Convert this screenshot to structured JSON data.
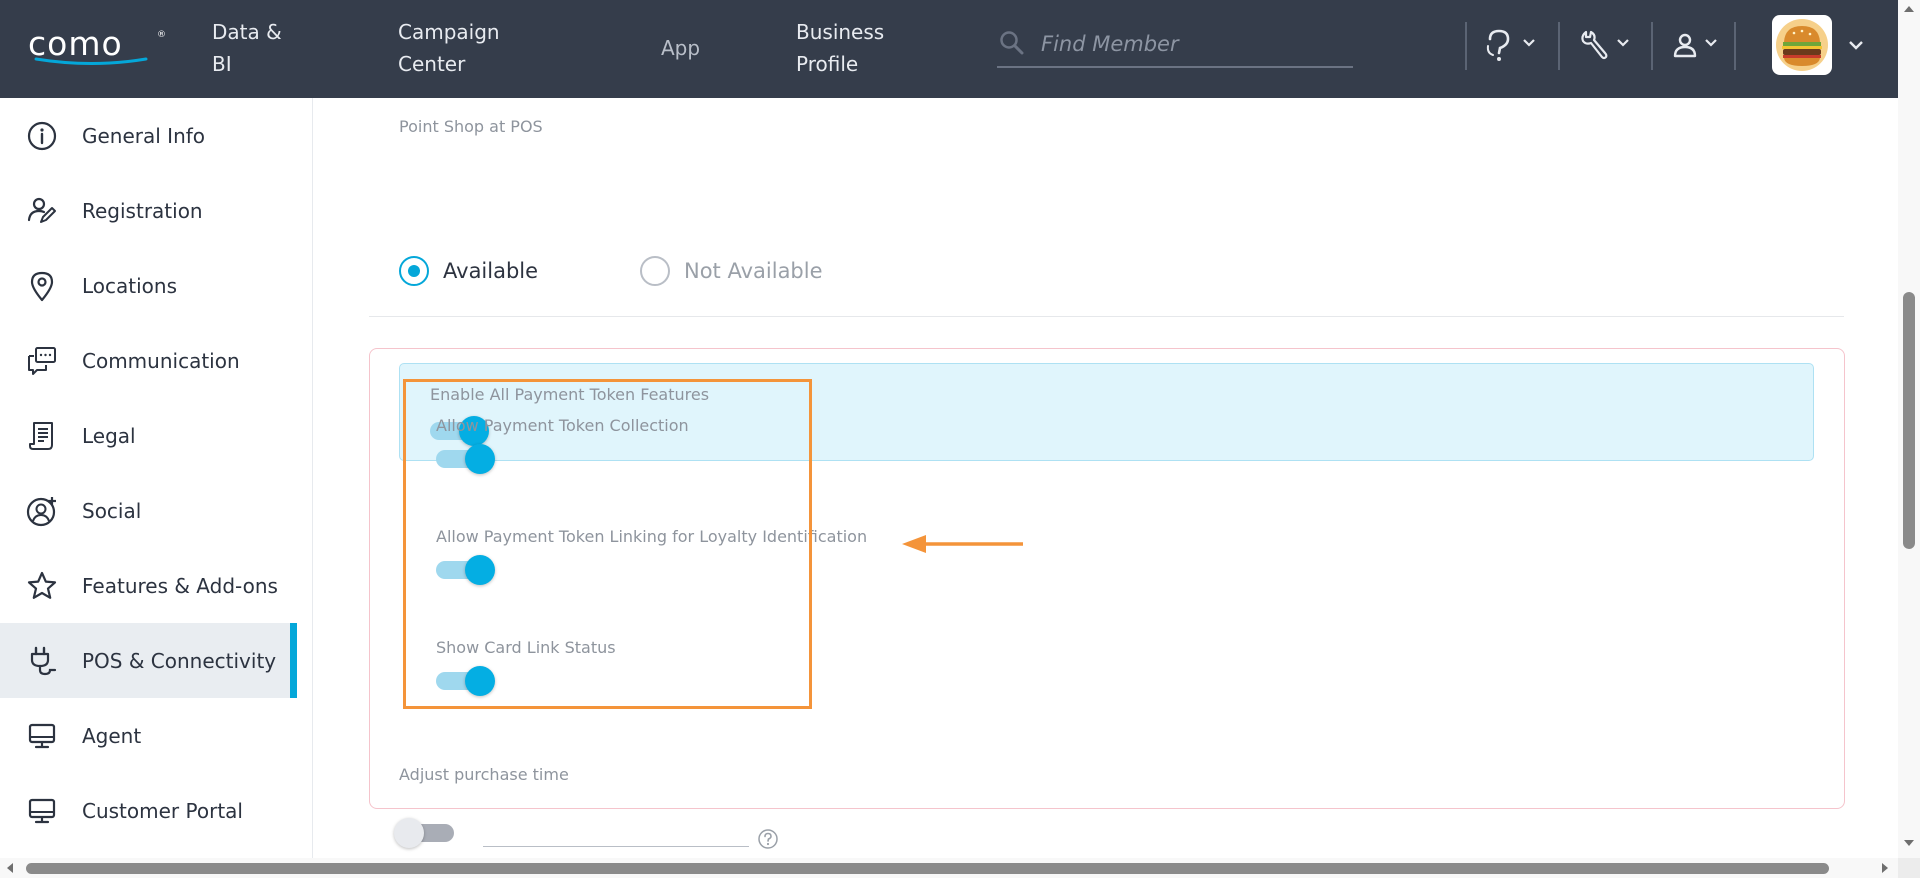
{
  "brand": {
    "logo_text": "como",
    "accent": "#04a7d9",
    "topbar_bg": "#353d4b",
    "highlight_color": "#f4943a"
  },
  "nav": {
    "data_bi": [
      "Data &",
      "BI"
    ],
    "campaign": [
      "Campaign",
      "Center"
    ],
    "app": "App",
    "business": [
      "Business",
      "Profile"
    ]
  },
  "search": {
    "placeholder": "Find Member",
    "value": ""
  },
  "header_tools": [
    "help-icon",
    "wrench-icon",
    "user-icon",
    "business-avatar"
  ],
  "sidebar": {
    "items": [
      {
        "label": "General Info",
        "icon": "info-icon",
        "active": false
      },
      {
        "label": "Registration",
        "icon": "registration-icon",
        "active": false
      },
      {
        "label": "Locations",
        "icon": "location-pin-icon",
        "active": false
      },
      {
        "label": "Communication",
        "icon": "chat-icon",
        "active": false
      },
      {
        "label": "Legal",
        "icon": "document-icon",
        "active": false
      },
      {
        "label": "Social",
        "icon": "user-add-icon",
        "active": false
      },
      {
        "label": "Features & Add-ons",
        "icon": "star-icon",
        "active": false
      },
      {
        "label": "POS & Connectivity",
        "icon": "plug-icon",
        "active": true
      },
      {
        "label": "Agent",
        "icon": "monitor-icon",
        "active": false
      },
      {
        "label": "Customer Portal",
        "icon": "monitor-icon",
        "active": false
      }
    ]
  },
  "main": {
    "point_shop": {
      "label": "Point Shop at POS",
      "options": [
        "Available",
        "Not Available"
      ],
      "selected": "Available"
    },
    "payment_token": {
      "enable_all": {
        "label": "Enable All Payment Token Features",
        "on": true
      },
      "toggles": [
        {
          "label": "Allow Payment Token Collection",
          "on": true
        },
        {
          "label": "Allow Payment Token Linking for Loyalty Identification",
          "on": true
        },
        {
          "label": "Show Card Link Status",
          "on": true
        }
      ]
    },
    "adjust_purchase": {
      "label": "Adjust purchase time",
      "on": false,
      "value": ""
    }
  }
}
